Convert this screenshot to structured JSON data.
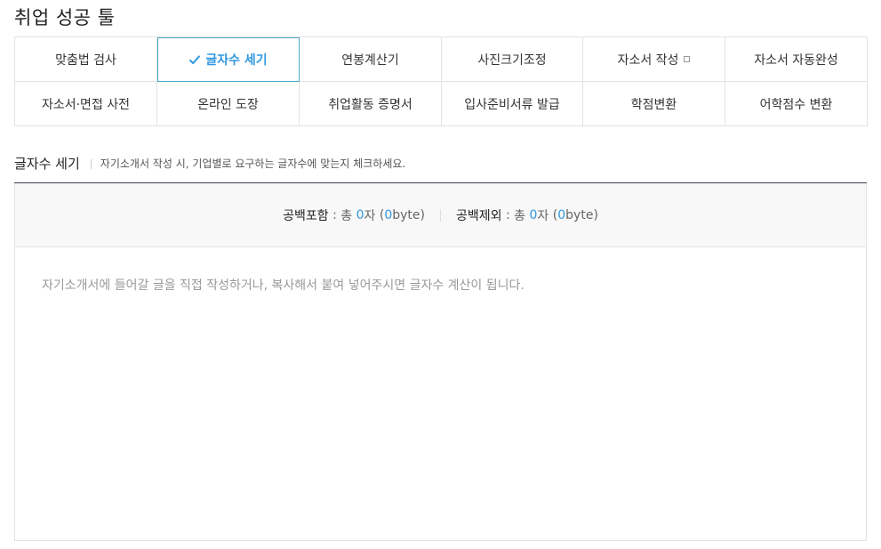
{
  "page": {
    "title": "취업 성공 툴"
  },
  "tools": [
    {
      "label": "맞춤법 검사",
      "active": false
    },
    {
      "label": "글자수 세기",
      "active": true
    },
    {
      "label": "연봉계산기",
      "active": false
    },
    {
      "label": "사진크기조정",
      "active": false
    },
    {
      "label": "자소서 작성",
      "active": false,
      "external": true
    },
    {
      "label": "자소서 자동완성",
      "active": false
    },
    {
      "label": "자소서·면접 사전",
      "active": false
    },
    {
      "label": "온라인 도장",
      "active": false
    },
    {
      "label": "취업활동 증명서",
      "active": false
    },
    {
      "label": "입사준비서류 발급",
      "active": false
    },
    {
      "label": "학점변환",
      "active": false
    },
    {
      "label": "어학점수 변환",
      "active": false
    }
  ],
  "section": {
    "title": "글자수 세기",
    "description": "자기소개서 작성 시, 기업별로 요구하는 글자수에 맞는지 체크하세요."
  },
  "counter": {
    "with_space": {
      "label": "공백포함",
      "prefix": "총",
      "count": "0",
      "unit": "자",
      "bytes": "0",
      "bytes_unit": "byte"
    },
    "without_space": {
      "label": "공백제외",
      "prefix": "총",
      "count": "0",
      "unit": "자",
      "bytes": "0",
      "bytes_unit": "byte"
    }
  },
  "input": {
    "value": "",
    "placeholder": "자기소개서에 들어갈 글을 직접 작성하거나, 복사해서 붙여 넣어주시면 글자수 계산이 됩니다."
  },
  "colors": {
    "accent": "#2f97e0",
    "active_border": "#4aa7c9",
    "header_rule": "#3b3f58"
  }
}
